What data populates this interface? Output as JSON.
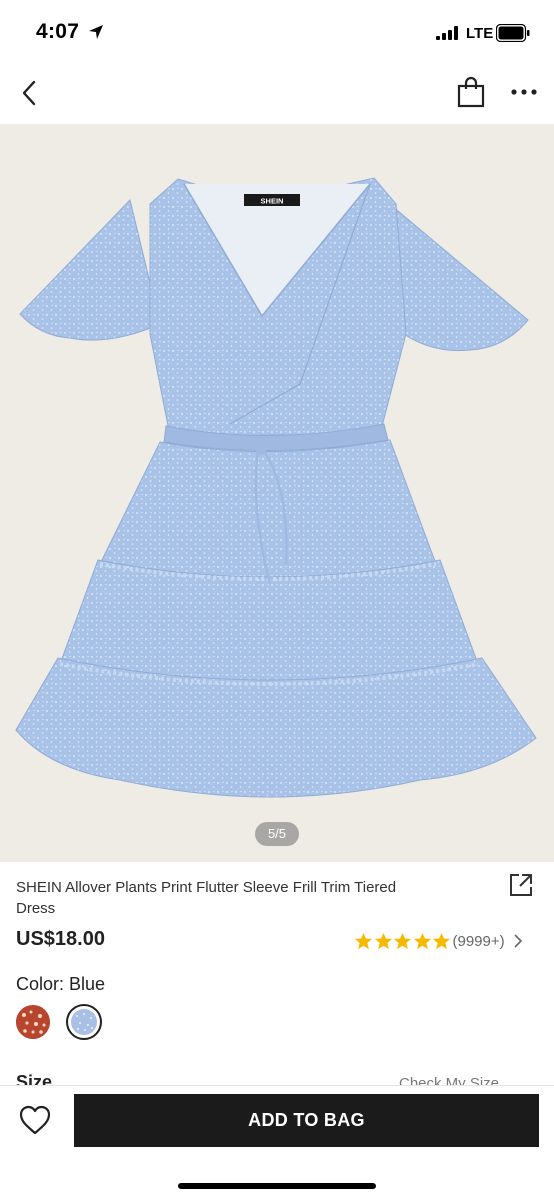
{
  "status_bar": {
    "time": "4:07",
    "carrier": "LTE"
  },
  "nav": {
    "back_icon": "chevron-left-icon",
    "bag_icon": "shopping-bag-icon",
    "more_icon": "more-dots-icon"
  },
  "gallery": {
    "page_indicator": "5/5",
    "brand_tag": "SHEIN",
    "background_color": "#efebe5",
    "dress_color": "#a9c3e8"
  },
  "product": {
    "title": "SHEIN Allover Plants Print Flutter Sleeve Frill Trim Tiered Dress",
    "price": "US$18.00",
    "rating_stars": 5,
    "review_count": "(9999+)",
    "star_color": "#f6b800",
    "color_label": "Color: Blue",
    "swatches": [
      {
        "name": "red-floral",
        "color": "#b8462e",
        "selected": false
      },
      {
        "name": "blue",
        "color": "#a9c0e6",
        "selected": true
      }
    ],
    "size_label": "Size",
    "check_size": "Check My Size"
  },
  "bottom_bar": {
    "add_to_bag": "ADD TO BAG",
    "button_color": "#1b1b1b"
  }
}
